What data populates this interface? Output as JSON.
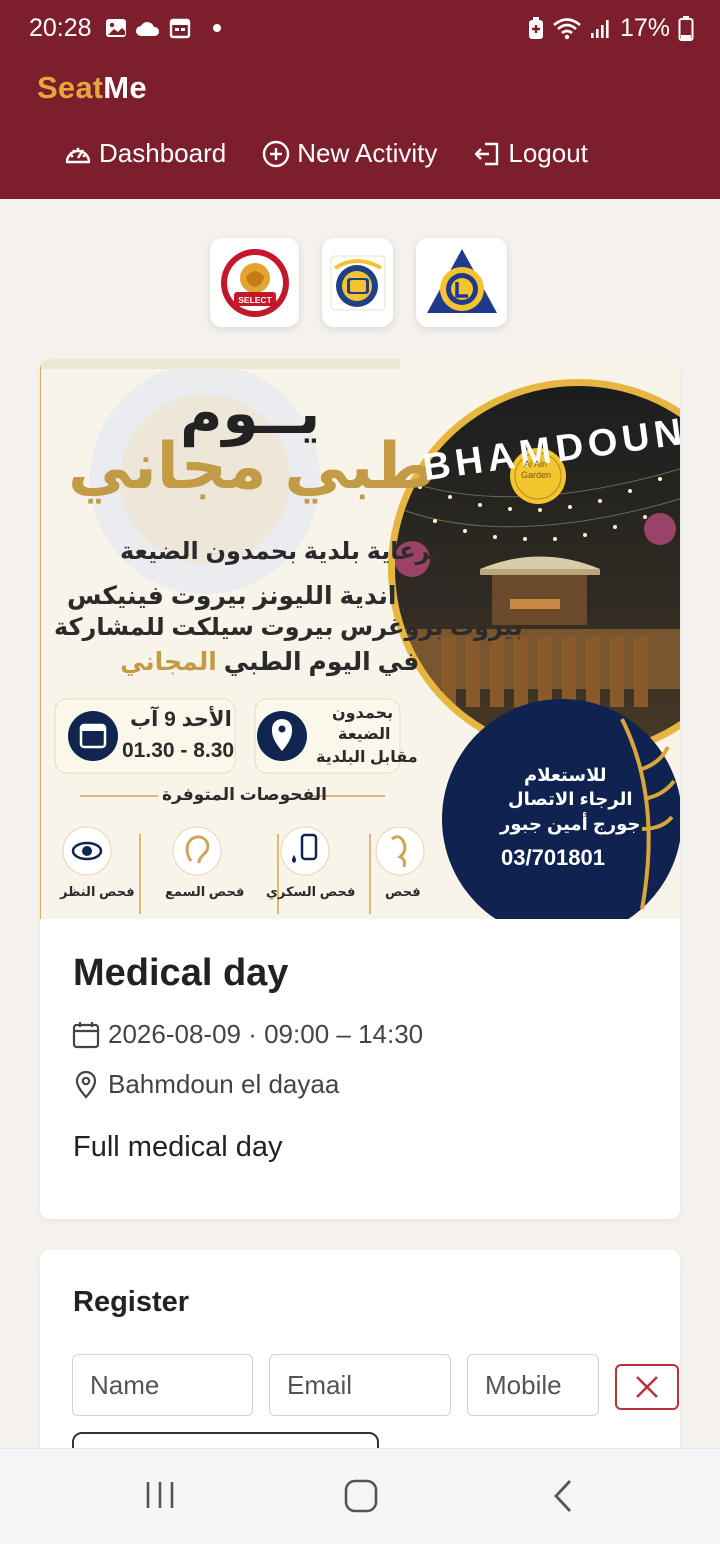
{
  "status_bar": {
    "time": "20:28",
    "battery": "17%"
  },
  "app": {
    "brand_part1": "Seat",
    "brand_part2": "Me",
    "colors": {
      "header": "#7c1e2c",
      "brand_accent": "#e3a73a"
    }
  },
  "nav": {
    "dashboard": "Dashboard",
    "new_activity": "New Activity",
    "logout": "Logout"
  },
  "logos": {
    "logo1_text": "SELECT"
  },
  "poster": {
    "headline1": "يــوم",
    "headline2": "طبي مجاني",
    "line1": "برعاية بلدية بحمدون الضيعة",
    "line2": "تدعوكم اندية الليونز بيروت فينيكس",
    "line3": "بيروت بروغرس بيروت سيلكت للمشاركة",
    "line4a": "في اليوم الطبي",
    "line4b": "المجاني",
    "date_label": "الأحد 9 آب",
    "time_label": "01.30 - 8.30",
    "place_line1": "بحمدون",
    "place_line2": "الضيعة",
    "place_line3": "مقابل البلدية",
    "checkups_title": "الفحوصات المتوفرة",
    "check1": "فحص النظر",
    "check2": "فحص السمع",
    "check3": "فحص السكري",
    "check4": "فحص",
    "venue_arc": "BHAMDOUN",
    "garden1": "Al Ain",
    "garden2": "Garden",
    "inquiry1": "للاستعلام",
    "inquiry2": "الرجاء الاتصال",
    "inquiry3": "جورج أمين جبور",
    "phone": "03/701801"
  },
  "event": {
    "title": "Medical day",
    "datetime": "2026-08-09 · 09:00 – 14:30",
    "location": "Bahmdoun el dayaa",
    "description": "Full medical day"
  },
  "register": {
    "title": "Register",
    "name_placeholder": "Name",
    "email_placeholder": "Email",
    "mobile_placeholder": "Mobile"
  }
}
